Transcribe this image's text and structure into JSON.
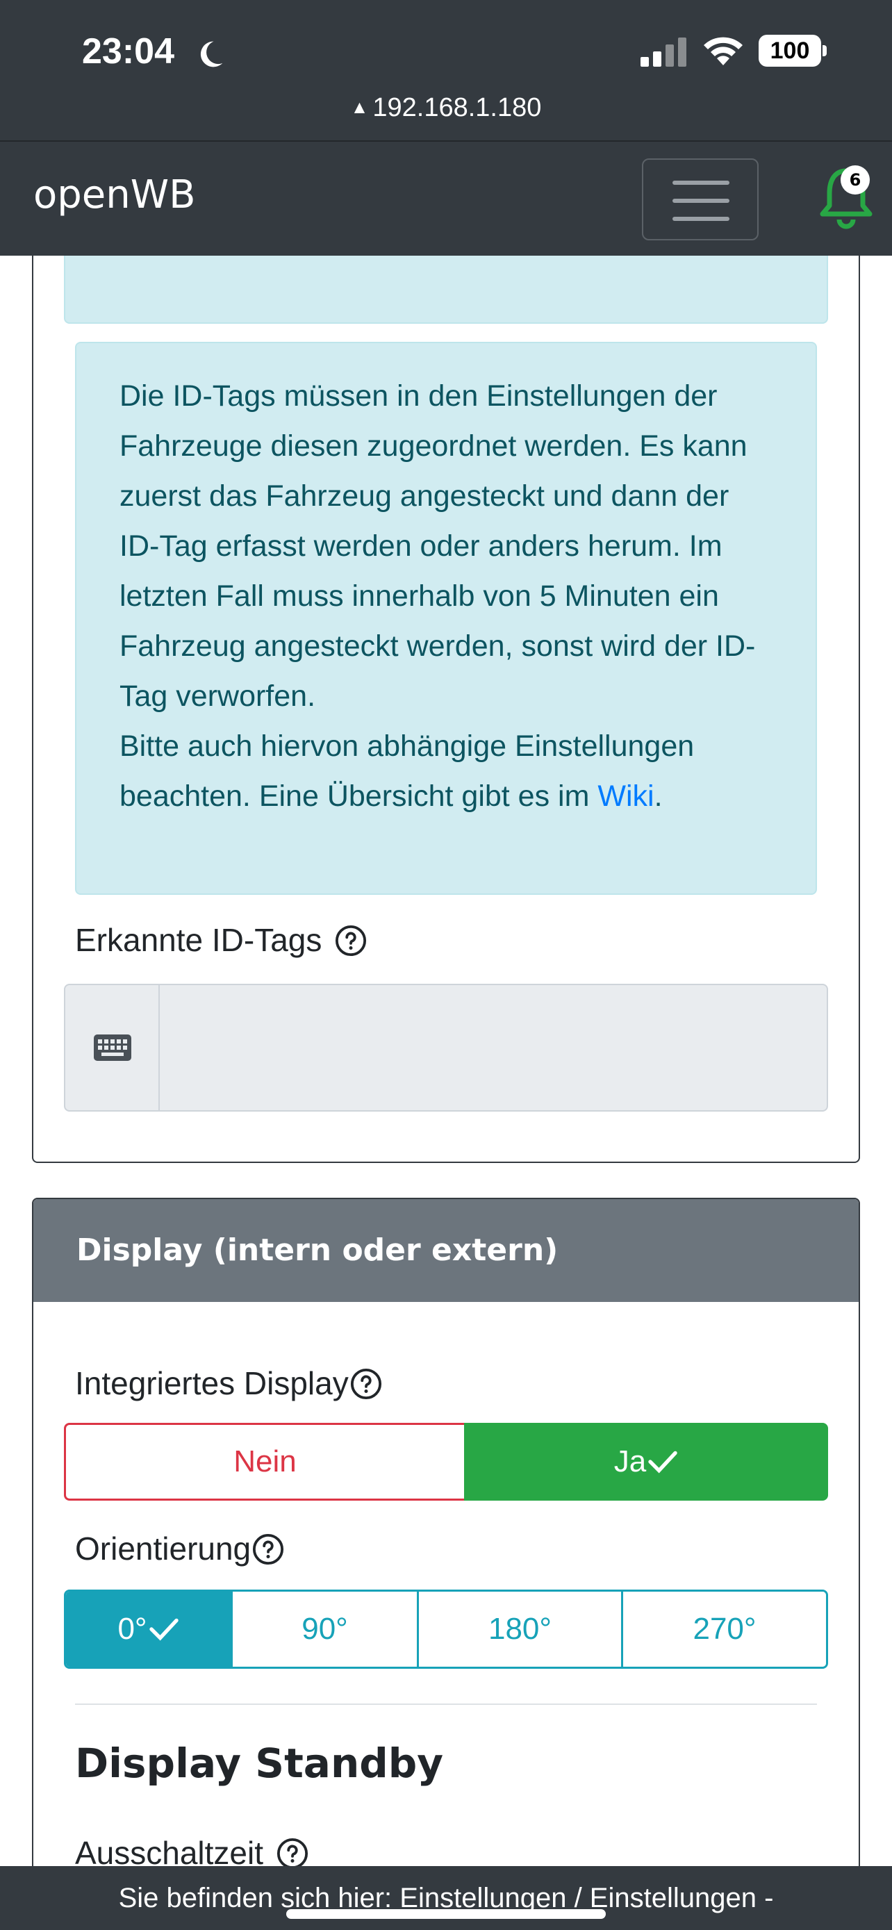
{
  "status_bar": {
    "time": "23:04",
    "battery": "100",
    "url": "192.168.1.180"
  },
  "navbar": {
    "brand": "openWB",
    "notification_count": "6"
  },
  "alert": {
    "text_main": "Die ID-Tags müssen in den Einstellungen der Fahrzeuge diesen zugeordnet werden. Es kann zuerst das Fahrzeug angesteckt und dann der ID-Tag erfasst werden oder anders herum. Im letzten Fall muss innerhalb von 5 Minuten ein Fahrzeug angesteckt werden, sonst wird der ID-Tag verworfen.",
    "text_second": "Bitte auch hiervon abhängige Einstellungen beachten. Eine Übersicht gibt es im ",
    "link_label": "Wiki",
    "text_end": "."
  },
  "idtags": {
    "label": "Erkannte ID-Tags",
    "value": ""
  },
  "display_card": {
    "header": "Display (intern oder extern)",
    "integrated_label": "Integriertes Display",
    "options_yn": {
      "no": "Nein",
      "yes": "Ja",
      "selected": "yes"
    },
    "orientation_label": "Orientierung",
    "orientation_options": [
      "0°",
      "90°",
      "180°",
      "270°"
    ],
    "orientation_selected": "0°",
    "standby_title": "Display Standby",
    "shutoff_label": "Ausschaltzeit"
  },
  "footer": {
    "breadcrumb": "Sie befinden sich hier: Einstellungen / Einstellungen -"
  },
  "colors": {
    "navbar": "#343a40",
    "info_bg": "#d1ecf1",
    "info_text": "#0c5460",
    "success": "#28a745",
    "danger": "#dc3545",
    "teal": "#17a2b8",
    "header_gray": "#6c757d"
  }
}
